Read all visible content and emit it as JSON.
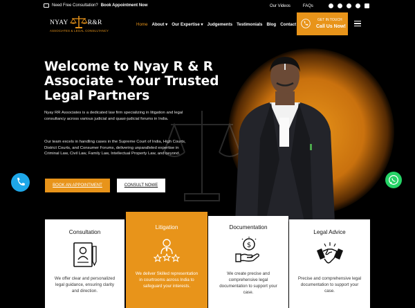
{
  "topbar": {
    "consult_text": "Need Free Consultation?",
    "book_link": "Book Appointment Now",
    "videos": "Our Videos",
    "faqs": "FAQs",
    "social_icons": [
      "facebook-icon",
      "twitter-icon",
      "youtube-icon",
      "instagram-icon",
      "linkedin-icon"
    ]
  },
  "logo": {
    "name_left": "NYAY",
    "name_right": "R&R",
    "tagline": "ASSOCIATES & LEGAL CONSULTANCY"
  },
  "nav": {
    "items": [
      {
        "label": "Home",
        "active": true
      },
      {
        "label": "About ▾",
        "active": false
      },
      {
        "label": "Our Expertise ▾",
        "active": false
      },
      {
        "label": "Judgements",
        "active": false
      },
      {
        "label": "Testimonials",
        "active": false
      },
      {
        "label": "Blog",
        "active": false
      },
      {
        "label": "Contact",
        "active": false
      }
    ]
  },
  "callbox": {
    "line1": "GET IN TOUCH",
    "line2": "Call Us Now!"
  },
  "hero": {
    "title": "Welcome to Nyay R & R Associate - Your Trusted Legal Partners",
    "para1": "Nyay RR Associates is a dedicated law firm specializing in litigation and legal consultancy across various judicial and quasi-judicial forums in India.",
    "para2": "Our team excels in handling cases in the Supreme Court of India, High Courts, District Courts, and Consumer Forums, delivering unparalleled expertise in Criminal Law, Civil Law, Family Law, Intellectual Property Law, and beyond.",
    "btn_primary": "BOOK AN APPOINTMENT",
    "btn_secondary": "CONSULT NOWE"
  },
  "cards": [
    {
      "title": "Consultation",
      "desc": "We offer clear and personalized legal guidance, ensuring clarity and direction.",
      "icon": "document-person-icon"
    },
    {
      "title": "Litigation",
      "desc": "We deliver Skilled representation in courtrooms across India to safeguard your interests.",
      "icon": "award-stars-icon"
    },
    {
      "title": "Documentation",
      "desc": "We create precise and comprehensive legal documentation to support your case.",
      "icon": "money-hand-icon"
    },
    {
      "title": "Legal Advice",
      "desc": "Precise and comprehensive legal documentation to support your case.",
      "icon": "handshake-icon"
    }
  ],
  "colors": {
    "accent": "#e8941a",
    "background": "#000000",
    "phone_float": "#1ea7e8",
    "whatsapp_float": "#25d366"
  }
}
